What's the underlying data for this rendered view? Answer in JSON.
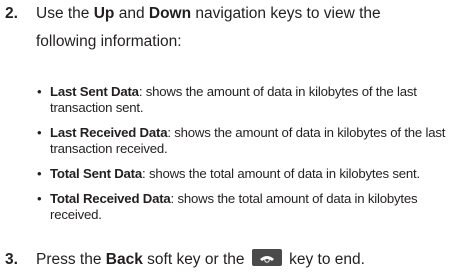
{
  "step2": {
    "number": "2.",
    "pre": "Use the ",
    "up": "Up",
    "mid": " and ",
    "down": "Down",
    "post_line1": " navigation keys to view the",
    "line2": "following information:"
  },
  "bullets": [
    {
      "title": "Last Sent Data",
      "text": ": shows the amount of data in kilobytes of the last transaction sent."
    },
    {
      "title": "Last Received Data",
      "text": ": shows the amount of data in kilobytes of the last transaction received."
    },
    {
      "title": "Total Sent Data",
      "text": ": shows the total amount of data in kilobytes sent."
    },
    {
      "title": "Total Received Data",
      "text": ": shows the total amount of data in kilobytes received."
    }
  ],
  "step3": {
    "number": "3.",
    "pre": "Press the ",
    "back": "Back",
    "mid": " soft key or the ",
    "icon": "end-key-icon",
    "post": " key to end."
  }
}
